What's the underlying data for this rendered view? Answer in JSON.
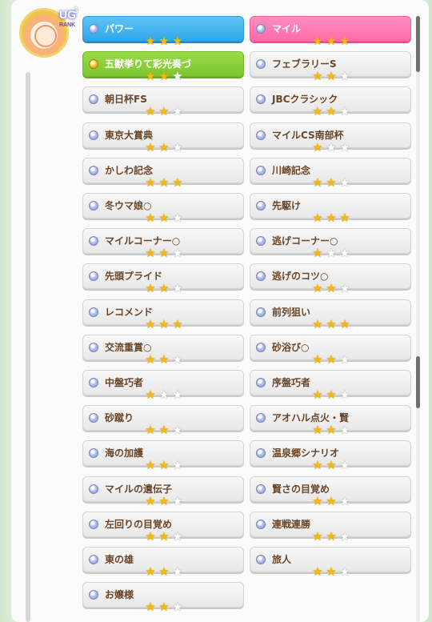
{
  "header": {
    "rank_badge_main": "UG",
    "rank_badge_sup": "3",
    "rank_badge_label": "RANK"
  },
  "colors": {
    "blue_skill": "#2ea7ea",
    "pink_skill": "#ff6aa9",
    "green_skill": "#7cc62f",
    "label_text": "#6a4527",
    "star_on": "#f6b80f"
  },
  "skills": [
    {
      "name": "パワー",
      "rating": 3,
      "style": "blue",
      "dot": "blue"
    },
    {
      "name": "マイル",
      "rating": 3,
      "style": "pink",
      "dot": "blue"
    },
    {
      "name": "五獣挙りて彩光奏づ",
      "rating": 2,
      "style": "green",
      "dot": "gold"
    },
    {
      "name": "フェブラリーS",
      "rating": 2,
      "style": "plain",
      "dot": "blue"
    },
    {
      "name": "朝日杯FS",
      "rating": 2,
      "style": "plain",
      "dot": "blue"
    },
    {
      "name": "JBCクラシック",
      "rating": 2,
      "style": "plain",
      "dot": "blue"
    },
    {
      "name": "東京大賞典",
      "rating": 2,
      "style": "plain",
      "dot": "blue"
    },
    {
      "name": "マイルCS南部杯",
      "rating": 1,
      "style": "plain",
      "dot": "blue"
    },
    {
      "name": "かしわ記念",
      "rating": 3,
      "style": "plain",
      "dot": "blue"
    },
    {
      "name": "川崎記念",
      "rating": 2,
      "style": "plain",
      "dot": "blue"
    },
    {
      "name": "冬ウマ娘○",
      "rating": 2,
      "style": "plain",
      "dot": "blue"
    },
    {
      "name": "先駆け",
      "rating": 3,
      "style": "plain",
      "dot": "blue"
    },
    {
      "name": "マイルコーナー○",
      "rating": 2,
      "style": "plain",
      "dot": "blue"
    },
    {
      "name": "逃げコーナー○",
      "rating": 1,
      "style": "plain",
      "dot": "blue"
    },
    {
      "name": "先頭プライド",
      "rating": 2,
      "style": "plain",
      "dot": "blue"
    },
    {
      "name": "逃げのコツ○",
      "rating": 2,
      "style": "plain",
      "dot": "blue"
    },
    {
      "name": "レコメンド",
      "rating": 3,
      "style": "plain",
      "dot": "blue"
    },
    {
      "name": "前列狙い",
      "rating": 3,
      "style": "plain",
      "dot": "blue"
    },
    {
      "name": "交流重賞○",
      "rating": 2,
      "style": "plain",
      "dot": "blue"
    },
    {
      "name": "砂浴び○",
      "rating": 2,
      "style": "plain",
      "dot": "blue"
    },
    {
      "name": "中盤巧者",
      "rating": 1,
      "style": "plain",
      "dot": "blue"
    },
    {
      "name": "序盤巧者",
      "rating": 2,
      "style": "plain",
      "dot": "blue"
    },
    {
      "name": "砂蹴り",
      "rating": 2,
      "style": "plain",
      "dot": "blue"
    },
    {
      "name": "アオハル点火・賢",
      "rating": 2,
      "style": "plain",
      "dot": "blue"
    },
    {
      "name": "海の加護",
      "rating": 2,
      "style": "plain",
      "dot": "blue"
    },
    {
      "name": "温泉郷シナリオ",
      "rating": 2,
      "style": "plain",
      "dot": "blue"
    },
    {
      "name": "マイルの遺伝子",
      "rating": 2,
      "style": "plain",
      "dot": "blue"
    },
    {
      "name": "賢さの目覚め",
      "rating": 2,
      "style": "plain",
      "dot": "blue"
    },
    {
      "name": "左回りの目覚め",
      "rating": 2,
      "style": "plain",
      "dot": "blue"
    },
    {
      "name": "連戦連勝",
      "rating": 2,
      "style": "plain",
      "dot": "blue"
    },
    {
      "name": "東の雄",
      "rating": 2,
      "style": "plain",
      "dot": "blue"
    },
    {
      "name": "旅人",
      "rating": 2,
      "style": "plain",
      "dot": "blue"
    },
    {
      "name": "お嬢様",
      "rating": 2,
      "style": "plain",
      "dot": "blue"
    }
  ]
}
